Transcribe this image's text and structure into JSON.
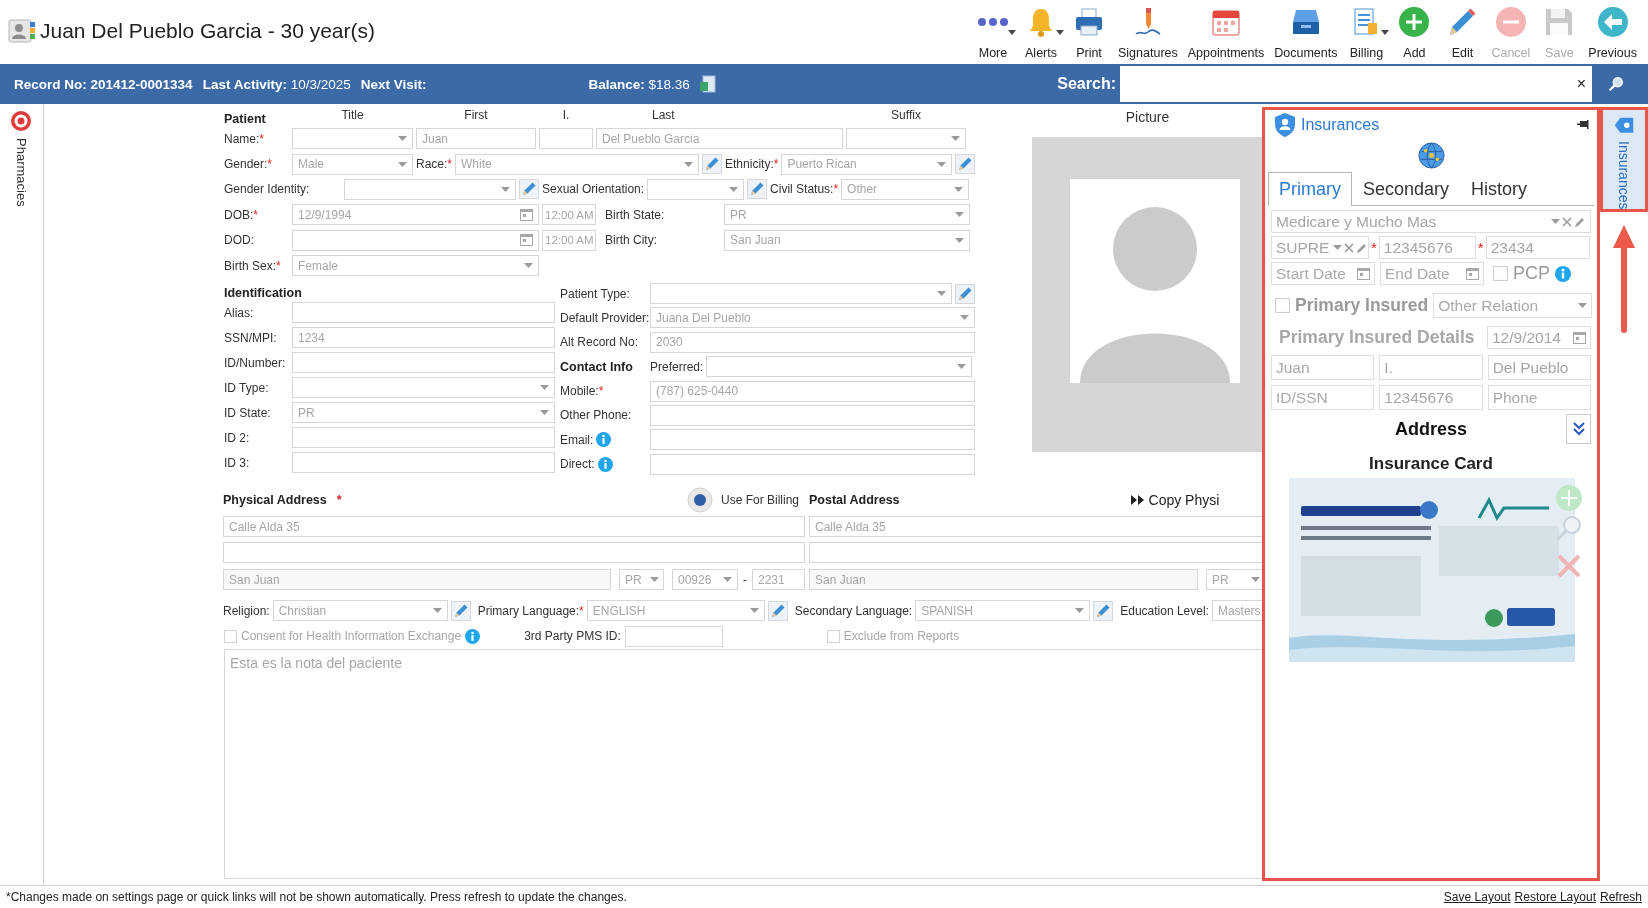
{
  "header": {
    "title": "Juan Del Pueblo Garcia - 30 year(s)",
    "toolbar": [
      {
        "kind": "more",
        "label": "More",
        "dropdown": true,
        "disabled": false
      },
      {
        "kind": "alerts",
        "label": "Alerts",
        "dropdown": true,
        "disabled": false
      },
      {
        "kind": "print",
        "label": "Print",
        "dropdown": false,
        "disabled": false
      },
      {
        "kind": "signatures",
        "label": "Signatures",
        "dropdown": false,
        "disabled": false
      },
      {
        "kind": "appointments",
        "label": "Appointments",
        "dropdown": false,
        "disabled": false
      },
      {
        "kind": "documents",
        "label": "Documents",
        "dropdown": false,
        "disabled": false
      },
      {
        "kind": "billing",
        "label": "Billing",
        "dropdown": true,
        "disabled": false
      },
      {
        "kind": "add",
        "label": "Add",
        "dropdown": false,
        "disabled": false
      },
      {
        "kind": "edit",
        "label": "Edit",
        "dropdown": false,
        "disabled": false
      },
      {
        "kind": "cancel",
        "label": "Cancel",
        "dropdown": false,
        "disabled": true
      },
      {
        "kind": "save",
        "label": "Save",
        "dropdown": false,
        "disabled": true
      },
      {
        "kind": "previous",
        "label": "Previous",
        "dropdown": false,
        "disabled": false
      }
    ]
  },
  "info_bar": {
    "record_label": "Record No:",
    "record": "201412-0001334",
    "activity_label": "Last Activity:",
    "activity": "10/3/2025",
    "next_visit_label": "Next Visit:",
    "balance_label": "Balance:",
    "balance": "$18.36",
    "search_label": "Search:",
    "search_clear": "×"
  },
  "side_tabs": {
    "left": "Pharmacies",
    "right": "Insurances"
  },
  "patient": {
    "heading": "Patient",
    "columns": [
      "Title",
      "First",
      "I.",
      "Last",
      "Suffix"
    ],
    "name": {
      "label": "Name:",
      "required_mark": "*",
      "title": {
        "kind": "select"
      },
      "first": {
        "kind": "text",
        "value": "Juan"
      },
      "middle": {
        "kind": "text"
      },
      "last": {
        "kind": "text",
        "value": "Del Pueblo Garcia"
      },
      "suffix": {
        "kind": "select"
      }
    },
    "gender": {
      "label": "Gender:",
      "required_mark": "*",
      "kind": "select",
      "value": "Male"
    },
    "race": {
      "label": "Race:",
      "required_mark": "*",
      "kind": "select",
      "value": "White",
      "editable": true
    },
    "ethnicity": {
      "label": "Ethnicity:",
      "required_mark": "*",
      "kind": "select",
      "value": "Puerto Rican",
      "editable": true
    },
    "gender_identity": {
      "label": "Gender Identity:",
      "kind": "select",
      "editable": true
    },
    "sexual_orientation": {
      "label": "Sexual Orientation:",
      "kind": "select",
      "editable": true
    },
    "civil_status": {
      "label": "Civil Status:",
      "required_mark": "*",
      "kind": "select",
      "value": "Other"
    },
    "dob": {
      "label": "DOB:",
      "required_mark": "*",
      "kind": "date",
      "value": "12/9/1994",
      "time": "12:00 AM"
    },
    "birth_state": {
      "label": "Birth State:",
      "kind": "select",
      "value": "PR"
    },
    "dod": {
      "label": "DOD:",
      "kind": "date",
      "time": "12:00 AM"
    },
    "birth_city": {
      "label": "Birth City:",
      "kind": "select",
      "value": "San Juan"
    },
    "birth_sex": {
      "label": "Birth Sex:",
      "required_mark": "*",
      "kind": "select",
      "value": "Female"
    }
  },
  "identification": {
    "heading": "Identification",
    "fields": [
      {
        "label": "Alias:",
        "kind": "text"
      },
      {
        "label": "SSN/MPI:",
        "kind": "text",
        "value": "1234"
      },
      {
        "label": "ID/Number:",
        "kind": "text"
      },
      {
        "label": "ID Type:",
        "kind": "select"
      },
      {
        "label": "ID State:",
        "kind": "select",
        "value": "PR"
      },
      {
        "label": "ID 2:",
        "kind": "text"
      },
      {
        "label": "ID 3:",
        "kind": "text"
      }
    ]
  },
  "details": [
    {
      "label": "Patient Type:",
      "kind": "select",
      "editable": true
    },
    {
      "label": "Default Provider:",
      "kind": "select",
      "value": "Juana Del Pueblo"
    },
    {
      "label": "Alt Record No:",
      "kind": "text",
      "value": "2030"
    },
    {
      "heading": "Contact Info",
      "label": "Preferred:",
      "kind": "select"
    },
    {
      "label": "Mobile:",
      "required_mark": "*",
      "kind": "text",
      "value": "(787) 625-0440"
    },
    {
      "label": "Other Phone:",
      "kind": "text"
    },
    {
      "label": "Email:",
      "kind": "text",
      "info": true
    },
    {
      "label": "Direct:",
      "kind": "text",
      "info": true
    }
  ],
  "picture": {
    "label": "Picture"
  },
  "address": {
    "use_for_billing": {
      "label": "Use For Billing",
      "selected": true
    },
    "copy": "Copy Physi",
    "physical": {
      "heading": "Physical Address",
      "required_mark": "*",
      "line1": "Calle Alda 35",
      "city": "San Juan",
      "state": "PR",
      "zip": "00926",
      "zip_separator": "-",
      "zip_ext": "2231"
    },
    "postal": {
      "heading": "Postal Address",
      "line1": "Calle Alda 35",
      "city": "San Juan",
      "state": "PR"
    }
  },
  "more": {
    "religion": {
      "label": "Religion:",
      "kind": "select",
      "value": "Christian",
      "editable": true
    },
    "primary_language": {
      "label": "Primary Language:",
      "required_mark": "*",
      "kind": "select",
      "value": "ENGLISH",
      "editable": true
    },
    "secondary_language": {
      "label": "Secondary Language:",
      "kind": "select",
      "value": "SPANISH",
      "editable": true
    },
    "education_level": {
      "label": "Education Level:",
      "kind": "select",
      "value": "Masters"
    },
    "consent": {
      "label": "Consent for Health Information Exchange",
      "checked": false,
      "info": true
    },
    "pms_id": {
      "label": "3rd Party PMS ID:",
      "kind": "text"
    },
    "exclude": {
      "label": "Exclude from Reports",
      "checked": false
    }
  },
  "notes": "Esta es la nota del paciente",
  "insurance": {
    "title": "Insurances",
    "tabs": [
      {
        "label": "Primary",
        "selected": true
      },
      {
        "label": "Secondary",
        "selected": false
      },
      {
        "label": "History",
        "selected": false
      }
    ],
    "plan": {
      "kind": "select",
      "value": "Medicare y Mucho Mas",
      "clearable": true,
      "editable": true
    },
    "plan_type": {
      "kind": "select",
      "value": "SUPRE",
      "clearable": true,
      "editable": true
    },
    "member_id": {
      "kind": "text",
      "value": "12345676",
      "required_mark": "*"
    },
    "group": {
      "kind": "text",
      "value": "23434",
      "required_mark": "*"
    },
    "start_date": {
      "kind": "date",
      "placeholder": "Start Date"
    },
    "end_date": {
      "kind": "date",
      "placeholder": "End Date"
    },
    "pcp": {
      "label": "PCP",
      "checked": false,
      "info": true
    },
    "primary_insured": {
      "label": "Primary Insured",
      "checked": false
    },
    "relation": {
      "kind": "select",
      "placeholder": "Other Relation"
    },
    "details_heading": "Primary Insured Details",
    "insured_dob": {
      "kind": "date",
      "value": "12/9/2014"
    },
    "insured_fields": [
      {
        "kind": "text",
        "value": "Juan"
      },
      {
        "kind": "text",
        "placeholder": "I."
      },
      {
        "kind": "text",
        "value": "Del Pueblo"
      },
      {
        "kind": "text",
        "placeholder": "ID/SSN"
      },
      {
        "kind": "text",
        "value": "12345676"
      },
      {
        "kind": "text",
        "placeholder": "Phone"
      }
    ],
    "address_heading": "Address",
    "card_heading": "Insurance Card"
  },
  "footer": {
    "note": "*Changes made on settings page or quick links will not be shown automatically. Press refresh to update the changes.",
    "links": [
      "Save Layout",
      "Restore Layout",
      "Refresh"
    ]
  }
}
